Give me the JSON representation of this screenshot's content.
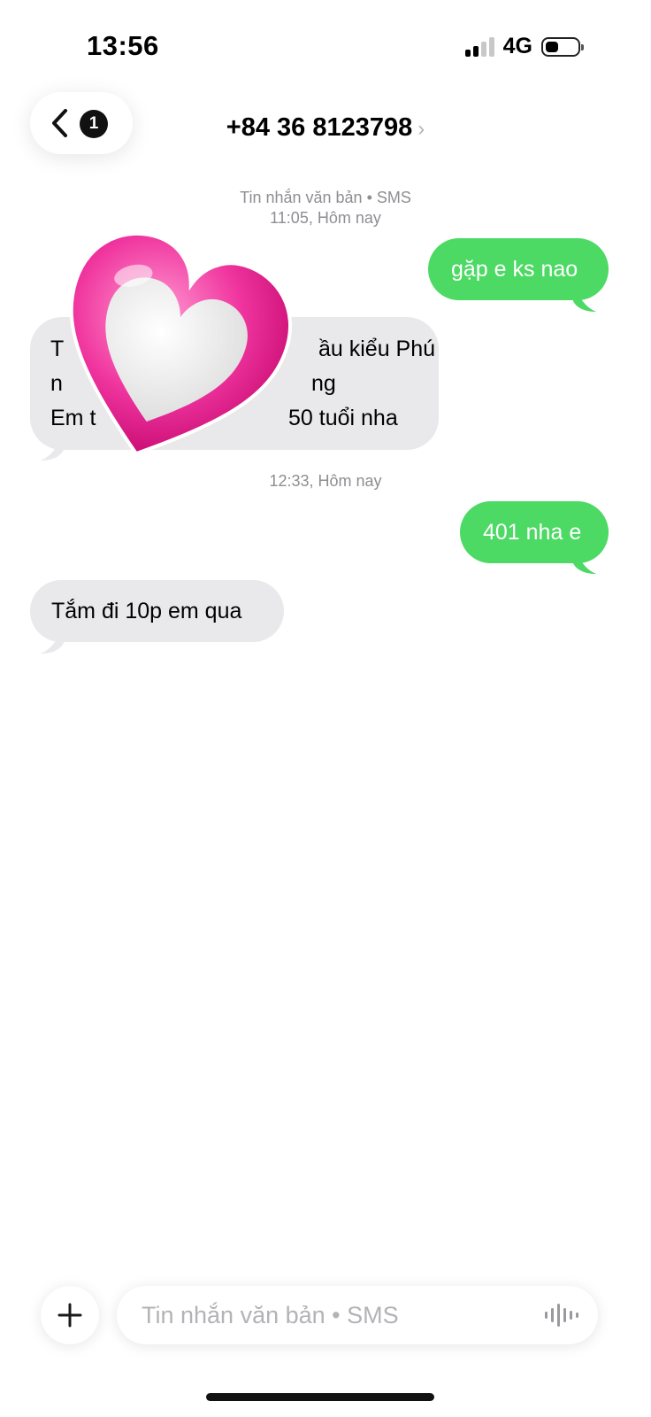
{
  "status_bar": {
    "time": "13:56",
    "network": "4G",
    "signal_bars": 2,
    "signal_max": 4
  },
  "header": {
    "unread_count": "1",
    "contact": "+84 36 8123798",
    "chevron": "›"
  },
  "thread": {
    "meta1_label": "Tin nhắn văn bản • SMS",
    "meta1_time": "11:05, Hôm nay",
    "meta2_time": "12:33, Hôm nay",
    "messages": [
      {
        "direction": "outgoing",
        "lines": [
          "gặp e ks nao"
        ]
      },
      {
        "direction": "incoming",
        "lines": [
          "T",
          "ầu kiểu Phú",
          "n",
          "ng",
          "Em t",
          "50 tuổi nha"
        ]
      },
      {
        "direction": "outgoing",
        "lines": [
          "401 nha e"
        ]
      },
      {
        "direction": "incoming",
        "lines": [
          "Tắm đi 10p em qua"
        ]
      }
    ]
  },
  "composer": {
    "placeholder": "Tin nhắn văn bản • SMS",
    "value": ""
  },
  "colors": {
    "outgoing_bubble": "#4cd964",
    "incoming_bubble": "#e9e9eb",
    "heart_pink": "#e8188f"
  },
  "icons": [
    "back-chevron-icon",
    "plus-icon",
    "waveform-icon",
    "heart-sticker"
  ]
}
